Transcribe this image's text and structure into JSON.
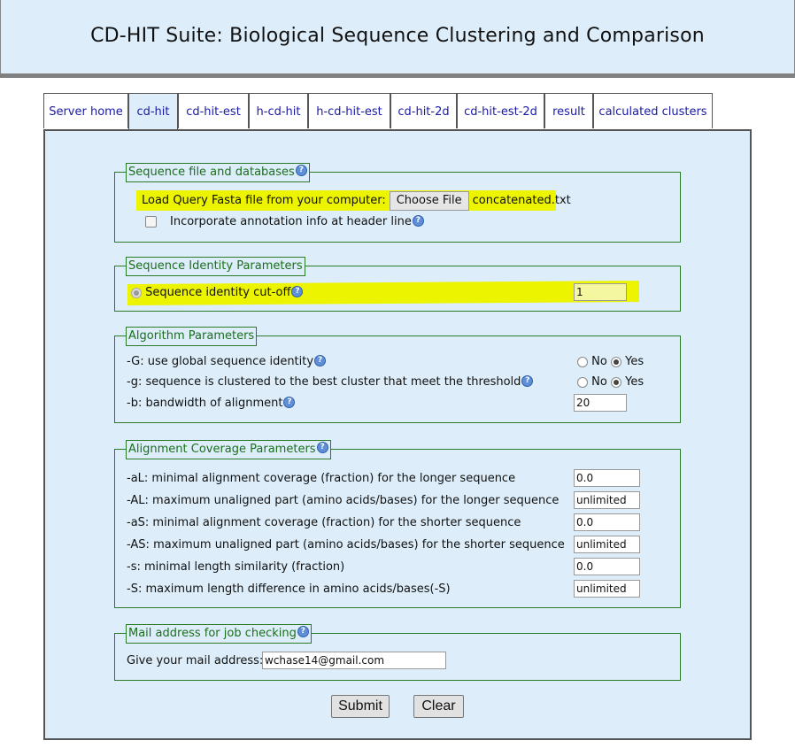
{
  "header": {
    "title": "CD-HIT Suite: Biological Sequence Clustering and Comparison"
  },
  "tabs": [
    {
      "label": "Server home"
    },
    {
      "label": "cd-hit"
    },
    {
      "label": "cd-hit-est"
    },
    {
      "label": "h-cd-hit"
    },
    {
      "label": "h-cd-hit-est"
    },
    {
      "label": "cd-hit-2d"
    },
    {
      "label": "cd-hit-est-2d"
    },
    {
      "label": "result"
    },
    {
      "label": "calculated clusters"
    }
  ],
  "active_tab": "cd-hit",
  "colors": {
    "panel_bg": "#ddeefa",
    "highlight": "#ecf400",
    "legend": "#1c6e1c",
    "tab_link": "#1a1aa6"
  },
  "sections": {
    "files": {
      "legend": "Sequence file and databases",
      "load_label": "Load Query Fasta file from your computer:",
      "choose_file_button": "Choose File",
      "chosen_file": "concatenated.txt",
      "annotation_label": "Incorporate annotation info at header line",
      "annotation_checked": false
    },
    "identity": {
      "legend": "Sequence Identity Parameters",
      "cutoff_label": "Sequence identity cut-off",
      "cutoff_value": "1"
    },
    "algorithm": {
      "legend": "Algorithm Parameters",
      "global_label": "-G: use global sequence identity",
      "global_value": "Yes",
      "best_label": "-g: sequence is clustered to the best cluster that meet the threshold",
      "best_value": "Yes",
      "bandwidth_label": "-b: bandwidth of alignment",
      "bandwidth_value": "20",
      "no_label": "No",
      "yes_label": "Yes"
    },
    "coverage": {
      "legend": "Alignment Coverage Parameters",
      "rows": [
        {
          "label": "-aL: minimal alignment coverage (fraction) for the longer sequence",
          "value": "0.0"
        },
        {
          "label": "-AL: maximum unaligned part (amino acids/bases) for the longer sequence",
          "value": "unlimited"
        },
        {
          "label": "-aS: minimal alignment coverage (fraction) for the shorter sequence",
          "value": "0.0"
        },
        {
          "label": "-AS: maximum unaligned part (amino acids/bases) for the shorter sequence",
          "value": "unlimited"
        },
        {
          "label": "-s: minimal length similarity (fraction)",
          "value": "0.0"
        },
        {
          "label": "-S: maximum length difference in amino acids/bases(-S)",
          "value": "unlimited"
        }
      ]
    },
    "mail": {
      "legend": "Mail address for job checking",
      "label": "Give your mail address:",
      "value": "wchase14@gmail.com"
    }
  },
  "buttons": {
    "submit": "Submit",
    "clear": "Clear"
  },
  "icons": {
    "help": "question-help-icon"
  }
}
